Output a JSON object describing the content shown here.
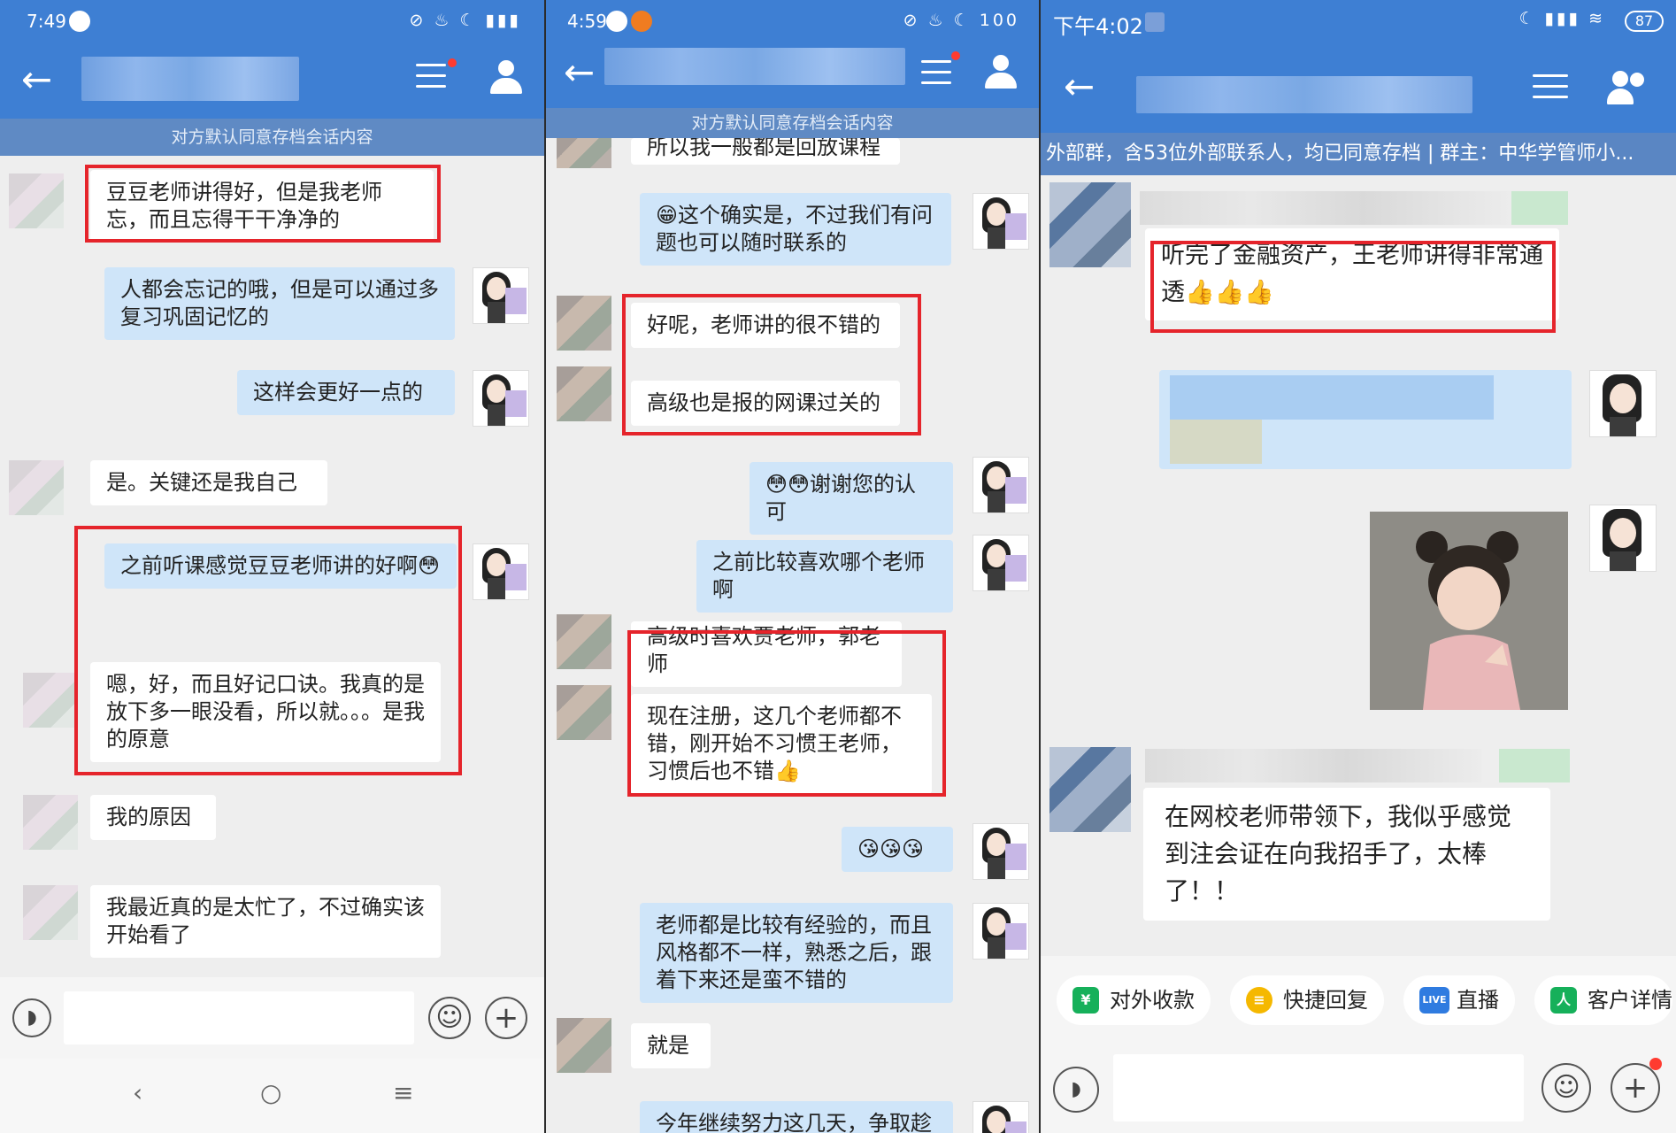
{
  "panel1": {
    "status_time": "7:49",
    "status_icons": "⊘ ♨ ☾ ▮▮▮",
    "consent_notice": "对方默认同意存档会话内容",
    "messages": [
      {
        "side": "in",
        "text": "豆豆老师讲得好，但是我老师忘，而且忘得干干净净的"
      },
      {
        "side": "out",
        "text": "人都会忘记的哦，但是可以通过多复习巩固记忆的"
      },
      {
        "side": "out",
        "text": "这样会更好一点的"
      },
      {
        "side": "in",
        "text": "是。关键还是我自己"
      },
      {
        "side": "out",
        "text": "之前听课感觉豆豆老师讲的好啊😳"
      },
      {
        "side": "in",
        "text": "嗯，好，而且好记口诀。我真的是放下多一眼没看，所以就。。。是我的原意"
      },
      {
        "side": "in",
        "text": "我的原因"
      },
      {
        "side": "in",
        "text": "我最近真的是太忙了，不过确实该开始看了"
      }
    ],
    "nav": {
      "back": "‹",
      "home": "○",
      "menu": "≡"
    }
  },
  "panel2": {
    "status_time": "4:59",
    "status_icons": "⊘ ♨ ☾ 100",
    "consent_notice": "对方默认同意存档会话内容",
    "partial_top": "所以我一般都是回放课程",
    "messages": [
      {
        "side": "out",
        "text": "😁这个确实是，不过我们有问题也可以随时联系的"
      },
      {
        "side": "in",
        "text": "好呢，老师讲的很不错的"
      },
      {
        "side": "in",
        "text": "高级也是报的网课过关的"
      },
      {
        "side": "out",
        "text": "😳😳谢谢您的认可"
      },
      {
        "side": "out",
        "text": "之前比较喜欢哪个老师啊"
      },
      {
        "side": "in",
        "text": "高级时喜欢贾老师，郭老师"
      },
      {
        "side": "in",
        "text": "现在注册，这几个老师都不错，刚开始不习惯王老师，习惯后也不错👍"
      },
      {
        "side": "out",
        "text": "😘😘😘"
      },
      {
        "side": "out",
        "text": "老师都是比较有经验的，而且风格都不一样，熟悉之后，跟着下来还是蛮不错的"
      },
      {
        "side": "in",
        "text": "就是"
      },
      {
        "side": "out",
        "text": "今年继续努力这几天，争取趁"
      }
    ]
  },
  "panel3": {
    "status_time": "下午4:02",
    "status_icons": "☾ ▮▮▮ ≋",
    "battery": "87",
    "group_info": "外部群，含53位外部联系人，均已同意存档 | 群主：中华学管师小...",
    "messages": [
      {
        "side": "in",
        "text": "听完了金融资产，王老师讲得非常通透👍👍👍"
      },
      {
        "side": "in",
        "text": "在网校老师带领下，我似乎感觉到注会证在向我招手了，太棒了！！"
      }
    ],
    "quick_actions": [
      {
        "label": "对外收款",
        "icon": "¥",
        "color": "#16b05a"
      },
      {
        "label": "快捷回复",
        "icon": "≡",
        "color": "#f5b800"
      },
      {
        "label": "直播",
        "icon": "LIVE",
        "color": "#2f7be0"
      },
      {
        "label": "客户详情",
        "icon": "人",
        "color": "#16b05a"
      }
    ]
  },
  "colors": {
    "header": "#3e7fd3",
    "bubble_out": "#cfe5f9",
    "highlight": "#e5242b"
  }
}
